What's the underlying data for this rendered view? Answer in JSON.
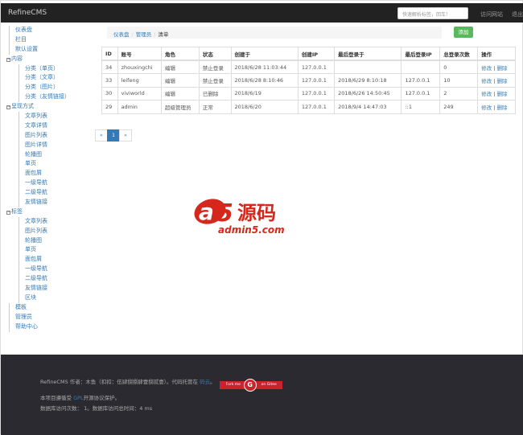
{
  "header": {
    "brand": "RefineCMS",
    "search_placeholder": "快速解析标签，回车！",
    "visit_site": "访问网站",
    "logout": "退出"
  },
  "sidebar": {
    "items": [
      {
        "label": "仪表盘",
        "level": 0
      },
      {
        "label": "栏目",
        "level": 0
      },
      {
        "label": "默认设置",
        "level": 0
      },
      {
        "label": "内容",
        "level": "group"
      },
      {
        "label": "分类（单页）",
        "level": 1
      },
      {
        "label": "分类（文章）",
        "level": 1
      },
      {
        "label": "分类（图片）",
        "level": 1
      },
      {
        "label": "分类（友情链接）",
        "level": 1
      },
      {
        "label": "呈现方式",
        "level": "group"
      },
      {
        "label": "文章列表",
        "level": 1
      },
      {
        "label": "文章详情",
        "level": 1
      },
      {
        "label": "图片列表",
        "level": 1
      },
      {
        "label": "图片详情",
        "level": 1
      },
      {
        "label": "轮播图",
        "level": 1
      },
      {
        "label": "单页",
        "level": 1
      },
      {
        "label": "面包屑",
        "level": 1
      },
      {
        "label": "一级导航",
        "level": 1
      },
      {
        "label": "二级导航",
        "level": 1
      },
      {
        "label": "友情链接",
        "level": 1
      },
      {
        "label": "标签",
        "level": "group"
      },
      {
        "label": "文章列表",
        "level": 1
      },
      {
        "label": "图片列表",
        "level": 1
      },
      {
        "label": "轮播图",
        "level": 1
      },
      {
        "label": "单页",
        "level": 1
      },
      {
        "label": "面包屑",
        "level": 1
      },
      {
        "label": "一级导航",
        "level": 1
      },
      {
        "label": "二级导航",
        "level": 1
      },
      {
        "label": "友情链接",
        "level": 1
      },
      {
        "label": "区块",
        "level": 1
      },
      {
        "label": "模板",
        "level": 0
      },
      {
        "label": "管理员",
        "level": 0
      },
      {
        "label": "帮助中心",
        "level": 0
      }
    ]
  },
  "breadcrumb": [
    "仪表盘",
    "管理员",
    "清单"
  ],
  "add_label": "添加",
  "table": {
    "headers": [
      "ID",
      "账号",
      "角色",
      "状态",
      "创建于",
      "创建IP",
      "最后登录于",
      "最后登录IP",
      "总登录次数",
      "操作"
    ],
    "rows": [
      [
        "34",
        "zhouxingchi",
        "编辑",
        "禁止登录",
        "2018/6/28 11:03:44",
        "127.0.0.1",
        "",
        "",
        "0"
      ],
      [
        "33",
        "leifeng",
        "编辑",
        "禁止登录",
        "2018/6/28 8:10:46",
        "127.0.0.1",
        "2018/6/29 8:10:18",
        "127.0.0.1",
        "10"
      ],
      [
        "30",
        "viviworld",
        "编辑",
        "已删除",
        "2018/6/19",
        "127.0.0.1",
        "2018/6/26 14:50:45",
        "127.0.0.1",
        "2"
      ],
      [
        "29",
        "admin",
        "超级管理员",
        "正常",
        "2018/6/20",
        "127.0.0.1",
        "2018/9/4 14:47:03",
        "::1",
        "249"
      ]
    ],
    "edit": "修改",
    "delete": "删除"
  },
  "pagination": {
    "prev": "«",
    "current": "1",
    "next": "»"
  },
  "watermark": {
    "text": "a5源码",
    "url": "admin5.com"
  },
  "footer": {
    "line1": "RefineCMS 作者：木鱼（扣扣：伍肆捌捌肆壹捌贰壹）。代码托管在 ",
    "link1": "码云",
    "line1_end": "。",
    "ribbon_left": "Fork me",
    "ribbon_right": "on Gitee",
    "line2_pre": "本项目遵循受 ",
    "gpl": "GPL",
    "line2_post": "开源协议保护。",
    "line3": "数据库访问次数： 1。数据库访问总时间：4 ms"
  }
}
